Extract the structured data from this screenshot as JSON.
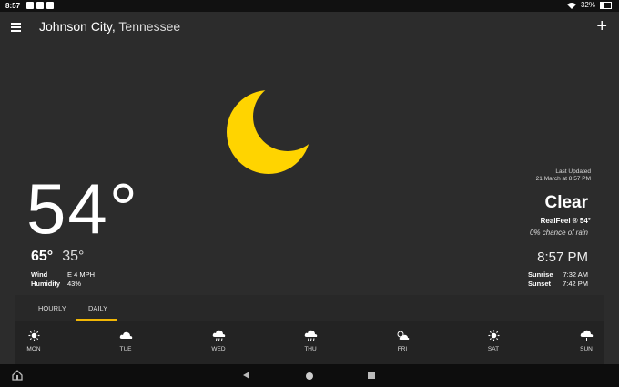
{
  "status_bar": {
    "time": "8:57",
    "battery": "32%"
  },
  "header": {
    "city": "Johnson City,",
    "region": " Tennessee"
  },
  "current": {
    "temperature": "54°",
    "high": "65°",
    "low": "35°",
    "wind_label": "Wind",
    "wind_value": "E 4 MPH",
    "humidity_label": "Humidity",
    "humidity_value": "43%",
    "last_updated_label": "Last Updated",
    "last_updated_value": "21 March at 8:57 PM",
    "condition": "Clear",
    "realfeel": "RealFeel ® 54°",
    "rain_chance": "0% chance of rain",
    "local_time": "8:57 PM",
    "sunrise_label": "Sunrise",
    "sunrise_value": "7:32 AM",
    "sunset_label": "Sunset",
    "sunset_value": "7:42 PM"
  },
  "forecast": {
    "tabs": [
      {
        "label": "HOURLY"
      },
      {
        "label": "DAILY"
      }
    ],
    "active_tab": "DAILY",
    "days": [
      {
        "label": "MON",
        "icon": "sun-icon"
      },
      {
        "label": "TUE",
        "icon": "cloud-icon"
      },
      {
        "label": "WED",
        "icon": "cloud-rain-icon"
      },
      {
        "label": "THU",
        "icon": "cloud-rain-icon"
      },
      {
        "label": "FRI",
        "icon": "partly-cloudy-icon"
      },
      {
        "label": "SAT",
        "icon": "sun-icon"
      },
      {
        "label": "SUN",
        "icon": "cloud-rain-icon"
      }
    ]
  },
  "colors": {
    "background": "#2c2c2c",
    "moon": "#ffd400",
    "accent": "#f2b705"
  }
}
